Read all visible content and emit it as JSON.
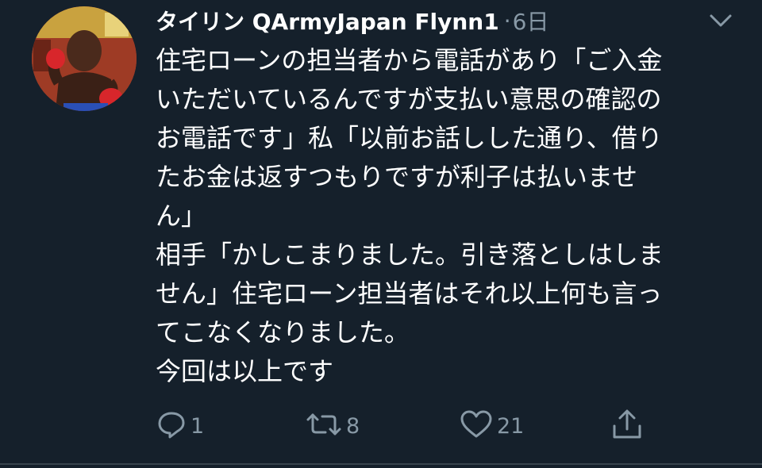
{
  "tweet": {
    "display_name": "タイリン QArmyJapan Flynn1",
    "separator": "·",
    "timestamp": "6日",
    "lines": [
      "住宅ローンの担当者から電話があり「ご入金",
      "いただいているんですが支払い意思の確認の",
      "お電話です」私「以前お話しした通り、借り",
      "たお金は返すつもりですが利子は払いませ",
      "ん」",
      "相手「かしこまりました。引き落としはしま",
      "せん」住宅ローン担当者はそれ以上何も言っ",
      "てこなくなりました。",
      "今回は以上です"
    ]
  },
  "actions": {
    "reply_count": "1",
    "retweet_count": "8",
    "like_count": "21"
  },
  "icons": {
    "avatar": "avatar-boxer-photo",
    "menu": "chevron-down-icon",
    "reply": "reply-icon",
    "retweet": "retweet-icon",
    "like": "heart-icon",
    "share": "share-icon"
  },
  "colors": {
    "background": "#15202b",
    "text": "#ffffff",
    "secondary": "#8899a6",
    "divider": "#38444d"
  }
}
